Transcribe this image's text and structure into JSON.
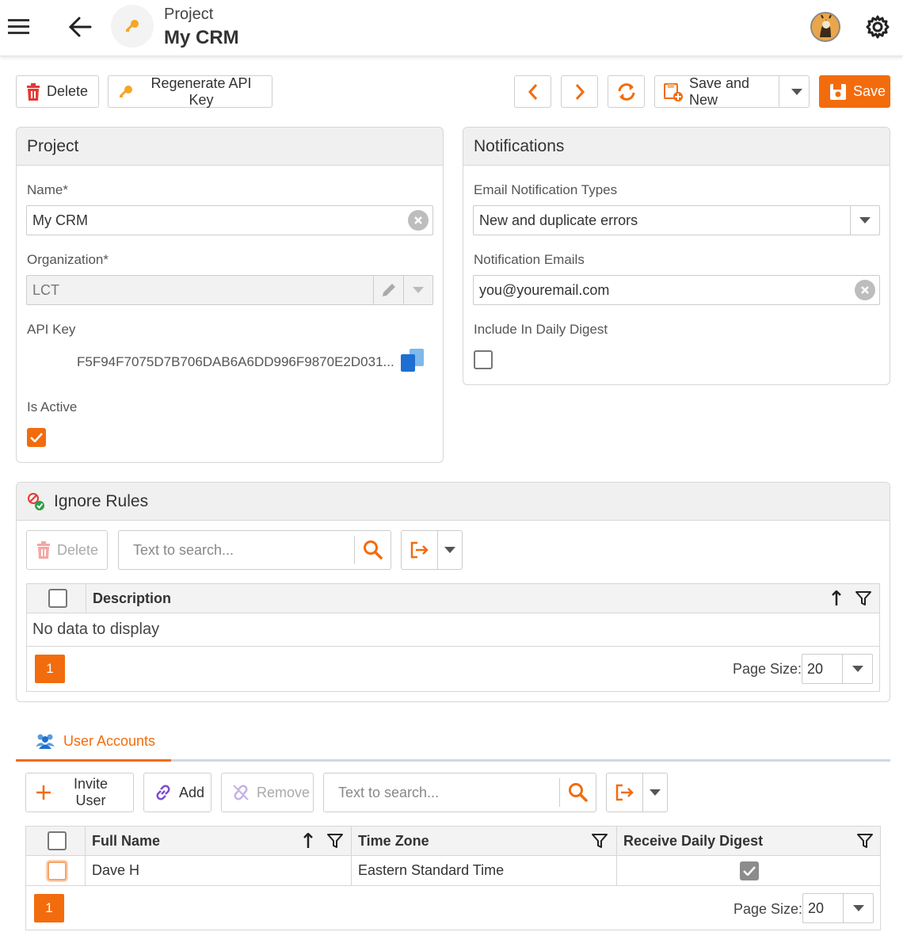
{
  "header": {
    "subtitle": "Project",
    "title": "My CRM",
    "icons": [
      "hamburger-icon",
      "back-arrow-icon",
      "key-icon",
      "avatar",
      "gear-icon"
    ]
  },
  "toolbar": {
    "delete_label": "Delete",
    "regenerate_label": "Regenerate API Key",
    "save_and_new_label": "Save and New",
    "save_label": "Save"
  },
  "project_panel": {
    "title": "Project",
    "name_label": "Name*",
    "name_value": "My CRM",
    "org_label": "Organization*",
    "org_value": "LCT",
    "api_key_label": "API Key",
    "api_key_value": "F5F94F7075D7B706DAB6A6DD996F9870E2D031...",
    "is_active_label": "Is Active",
    "is_active": true
  },
  "notifications_panel": {
    "title": "Notifications",
    "types_label": "Email Notification Types",
    "types_value": "New and duplicate errors",
    "emails_label": "Notification Emails",
    "emails_value": "you@youremail.com",
    "digest_label": "Include In Daily Digest",
    "digest": false
  },
  "ignore_rules": {
    "title": "Ignore Rules",
    "delete_label": "Delete",
    "search_placeholder": "Text to search...",
    "columns": [
      "Description"
    ],
    "empty_text": "No data to display",
    "page": "1",
    "page_size_label": "Page Size:",
    "page_size": "20"
  },
  "user_accounts": {
    "tab_label": "User Accounts",
    "invite_label": "Invite User",
    "add_label": "Add",
    "remove_label": "Remove",
    "search_placeholder": "Text to search...",
    "columns": [
      "Full Name",
      "Time Zone",
      "Receive Daily Digest"
    ],
    "rows": [
      {
        "full_name": "Dave H",
        "time_zone": "Eastern Standard Time",
        "receive_daily_digest": true
      }
    ],
    "page": "1",
    "page_size_label": "Page Size:",
    "page_size": "20"
  },
  "colors": {
    "accent": "#f26c0d",
    "link_blue": "#1e6fd1",
    "delete_red": "#e53935"
  }
}
